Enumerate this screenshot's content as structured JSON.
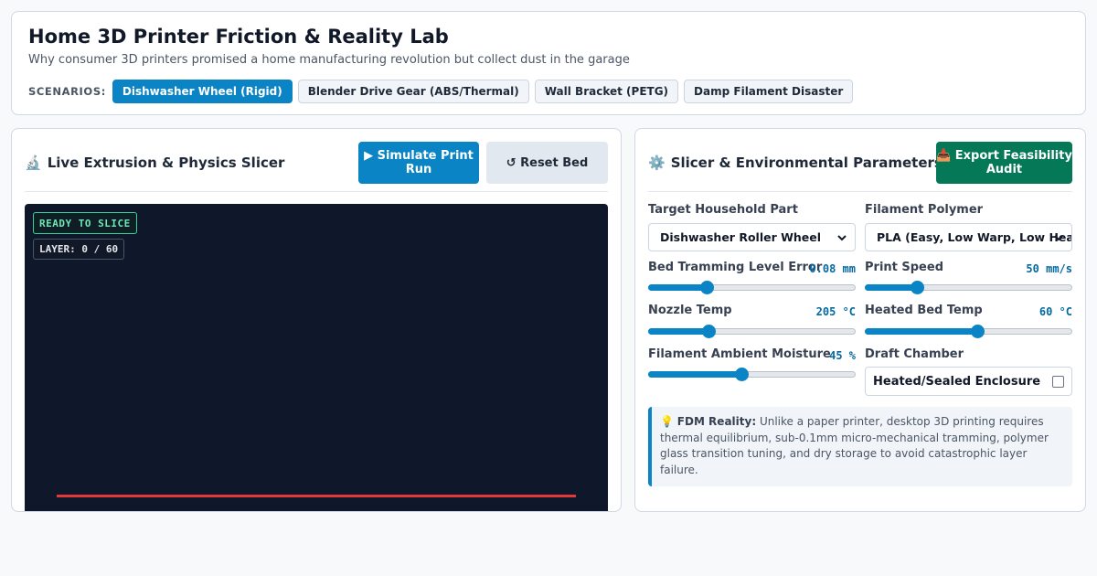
{
  "header": {
    "title": "Home 3D Printer Friction & Reality Lab",
    "subtitle": "Why consumer 3D printers promised a home manufacturing revolution but collect dust in the garage",
    "scenarios_label": "SCENARIOS:",
    "scenarios": [
      {
        "label": "Dishwasher Wheel (Rigid)",
        "active": true
      },
      {
        "label": "Blender Drive Gear (ABS/Thermal)",
        "active": false
      },
      {
        "label": "Wall Bracket (PETG)",
        "active": false
      },
      {
        "label": "Damp Filament Disaster",
        "active": false
      }
    ]
  },
  "left_panel": {
    "icon": "🔬",
    "title": "Live Extrusion & Physics Slicer",
    "simulate_label": "▶ Simulate Print Run",
    "reset_label": "↺ Reset Bed",
    "status": "READY TO SLICE",
    "layer": "LAYER: 0 / 60"
  },
  "right_panel": {
    "icon": "⚙️",
    "title": "Slicer & Environmental Parameters",
    "export_label": "📥 Export Feasibility Audit",
    "target_part": {
      "label": "Target Household Part",
      "value": "Dishwasher Roller Wheel"
    },
    "filament": {
      "label": "Filament Polymer",
      "value": "PLA (Easy, Low Warp, Low Heat)"
    },
    "tramming": {
      "label": "Bed Tramming Level Error",
      "value": "0.08 mm",
      "fraction": 0.28
    },
    "speed": {
      "label": "Print Speed",
      "value": "50 mm/s",
      "fraction": 0.25
    },
    "nozzle": {
      "label": "Nozzle Temp",
      "value": "205 °C",
      "fraction": 0.29
    },
    "bed_temp": {
      "label": "Heated Bed Temp",
      "value": "60 °C",
      "fraction": 0.54
    },
    "moisture": {
      "label": "Filament Ambient Moisture",
      "value": "45 %",
      "fraction": 0.45
    },
    "chamber": {
      "label": "Draft Chamber",
      "option": "Heated/Sealed Enclosure",
      "checked": false
    },
    "info": {
      "icon": "💡",
      "heading": "FDM Reality:",
      "text": "Unlike a paper printer, desktop 3D printing requires thermal equilibrium, sub-0.1mm micro-mechanical tramming, polymer glass transition tuning, and dry storage to avoid catastrophic layer failure."
    }
  },
  "colors": {
    "accent": "#0b84c6",
    "export": "#047857",
    "canvas": "#0f172a",
    "bed_line": "#e23a3a",
    "status_green": "#34d399"
  }
}
